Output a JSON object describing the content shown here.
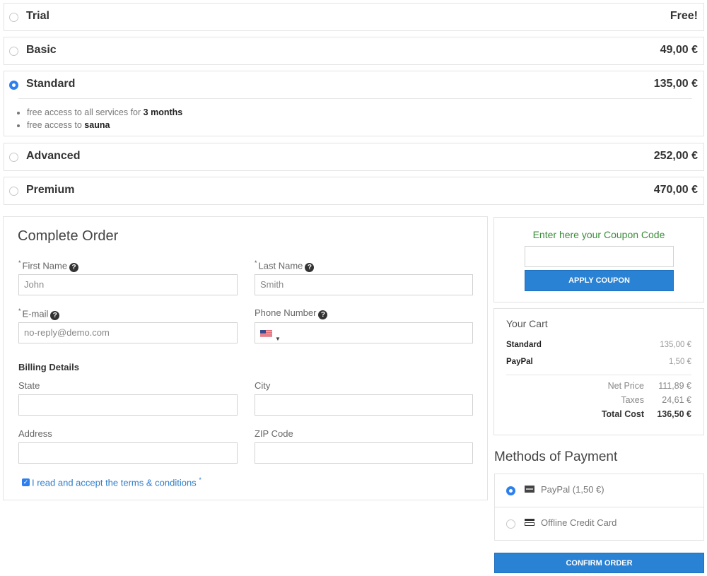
{
  "plans": [
    {
      "name": "Trial",
      "price": "Free!",
      "selected": false
    },
    {
      "name": "Basic",
      "price": "49,00 €",
      "selected": false
    },
    {
      "name": "Standard",
      "price": "135,00 €",
      "selected": true,
      "features": [
        {
          "text": "free access to all services for ",
          "bold": "3 months"
        },
        {
          "text": "free access to ",
          "bold": "sauna"
        }
      ]
    },
    {
      "name": "Advanced",
      "price": "252,00 €",
      "selected": false
    },
    {
      "name": "Premium",
      "price": "470,00 €",
      "selected": false
    }
  ],
  "order": {
    "title": "Complete Order",
    "required_mark": "*",
    "help_glyph": "?",
    "first_name": {
      "label": "First Name",
      "value": "John"
    },
    "last_name": {
      "label": "Last Name",
      "value": "Smith"
    },
    "email": {
      "label": "E-mail",
      "value": "no-reply@demo.com"
    },
    "phone": {
      "label": "Phone Number",
      "value": "",
      "country_flag": "us-flag-icon",
      "caret": "▼"
    },
    "billing_title": "Billing Details",
    "state": {
      "label": "State",
      "value": ""
    },
    "city": {
      "label": "City",
      "value": ""
    },
    "address": {
      "label": "Address",
      "value": ""
    },
    "zip": {
      "label": "ZIP Code",
      "value": ""
    },
    "terms": {
      "label": "I read and accept the terms & conditions",
      "checked": true,
      "check_glyph": "✓"
    }
  },
  "coupon": {
    "title": "Enter here your Coupon Code",
    "value": "",
    "button": "APPLY COUPON",
    "title_color": "#3c8d3c"
  },
  "cart": {
    "title": "Your Cart",
    "items": [
      {
        "name": "Standard",
        "price": "135,00 €"
      },
      {
        "name": "PayPal",
        "price": "1,50 €"
      }
    ],
    "net_price": {
      "label": "Net Price",
      "value": "111,89 €"
    },
    "taxes": {
      "label": "Taxes",
      "value": "24,61 €"
    },
    "total": {
      "label": "Total Cost",
      "value": "136,50 €"
    }
  },
  "payment": {
    "title": "Methods of Payment",
    "options": [
      {
        "label": "PayPal (1,50 €)",
        "icon": "paypal-icon",
        "selected": true
      },
      {
        "label": "Offline Credit Card",
        "icon": "credit-card-icon",
        "selected": false
      }
    ],
    "confirm_button": "CONFIRM ORDER"
  },
  "colors": {
    "accent": "#2a82d4",
    "radio_selected": "#2d7ff0",
    "link": "#2d7cc9"
  }
}
